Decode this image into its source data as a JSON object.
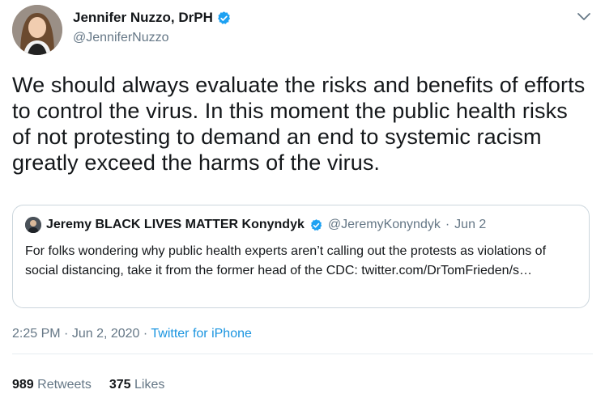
{
  "author": {
    "display_name": "Jennifer Nuzzo, DrPH",
    "handle": "@JenniferNuzzo",
    "verified": true
  },
  "tweet": {
    "text": "We should always evaluate the risks and benefits of efforts to control the virus. In this moment the public health risks of not protesting to demand an end to systemic racism greatly exceed the harms of the virus."
  },
  "quoted_tweet": {
    "display_name": "Jeremy BLACK LIVES MATTER Konyndyk",
    "handle": "@JeremyKonyndyk",
    "separator": "·",
    "date": "Jun 2",
    "text": "For folks wondering why public health experts aren’t calling out the protests as violations of social distancing, take it from the former head of the CDC: twitter.com/DrTomFrieden/s…"
  },
  "meta": {
    "time": "2:25 PM",
    "separator1": "·",
    "date": "Jun 2, 2020",
    "separator2": "·",
    "source": "Twitter for iPhone"
  },
  "stats": {
    "retweets_count": "989",
    "retweets_label": "Retweets",
    "likes_count": "375",
    "likes_label": "Likes"
  },
  "colors": {
    "verified": "#1da1f2",
    "link": "#1b95e0",
    "muted": "#657786"
  },
  "icons": {
    "verified": "verified-badge-icon",
    "caret": "chevron-down-icon"
  }
}
